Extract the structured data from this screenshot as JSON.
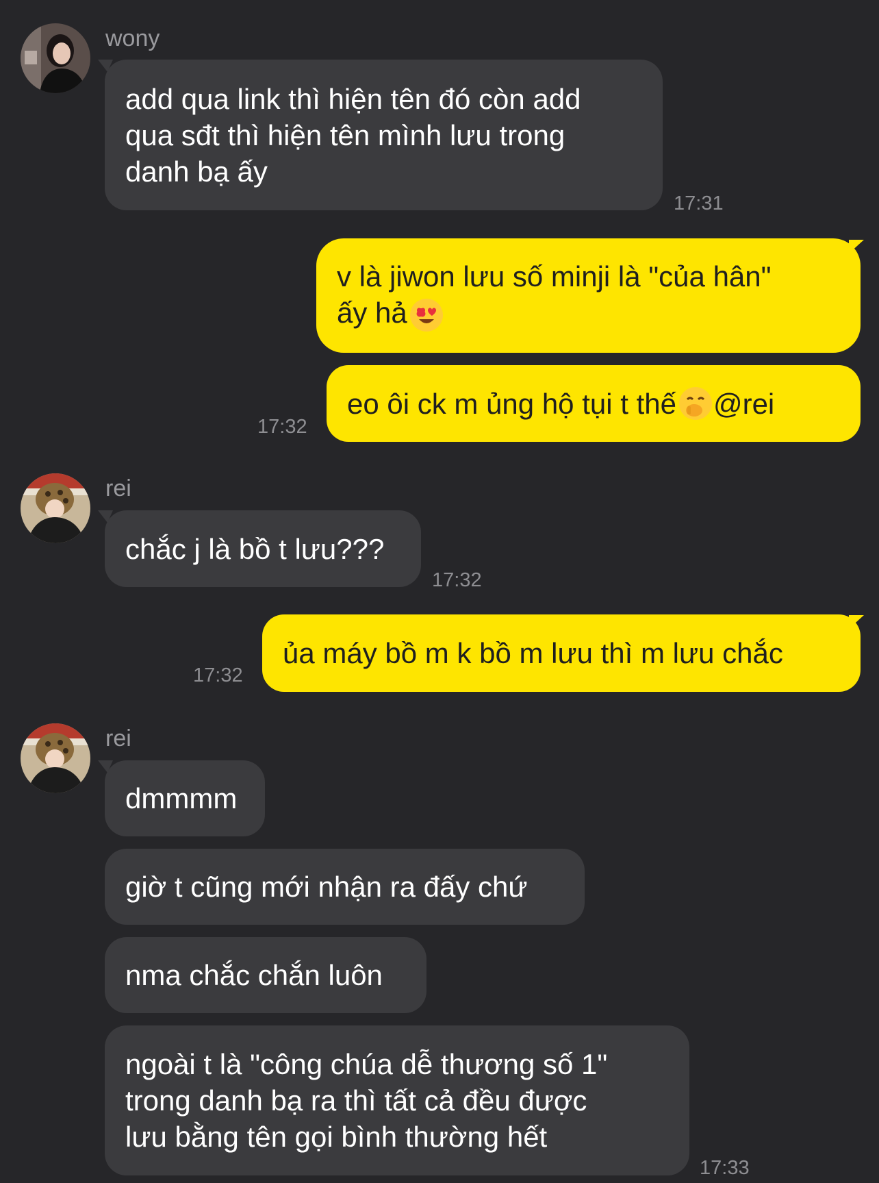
{
  "messages": [
    {
      "sender": "wony",
      "text": "add qua link thì hiện tên đó còn add\nqua sđt thì hiện tên mình lưu trong\ndanh bạ ấy",
      "time": "17:31"
    },
    {
      "text1": "v là jiwon lưu số minji là \"của hân\"",
      "text2": "ấy hả"
    },
    {
      "text": "eo ôi ck m ủng hộ tụi t thế",
      "mention": " @rei",
      "time": "17:32"
    },
    {
      "sender": "rei",
      "text": "chắc j là bồ t lưu???",
      "time": "17:32"
    },
    {
      "text": "ủa máy bồ m k bồ m lưu thì m lưu chắc",
      "time": "17:32"
    },
    {
      "sender": "rei",
      "text": "dmmmm"
    },
    {
      "text": "giờ t cũng mới nhận ra đấy chứ"
    },
    {
      "text": "nma chắc chắn luôn"
    },
    {
      "text": "ngoài t là \"công chúa dễ thương số 1\"\ntrong danh bạ ra thì tất cả đều được\nlưu bằng tên gọi bình thường hết",
      "time": "17:33"
    }
  ],
  "emojis": [
    "heart-eyes-emoji",
    "hand-over-mouth-emoji"
  ],
  "colors": {
    "background": "#262629",
    "incoming_bubble": "#3b3b3e",
    "outgoing_bubble": "#fee500",
    "outgoing_text": "#1f1f1f",
    "incoming_text": "#ffffff",
    "meta_text": "#8e8e92"
  }
}
